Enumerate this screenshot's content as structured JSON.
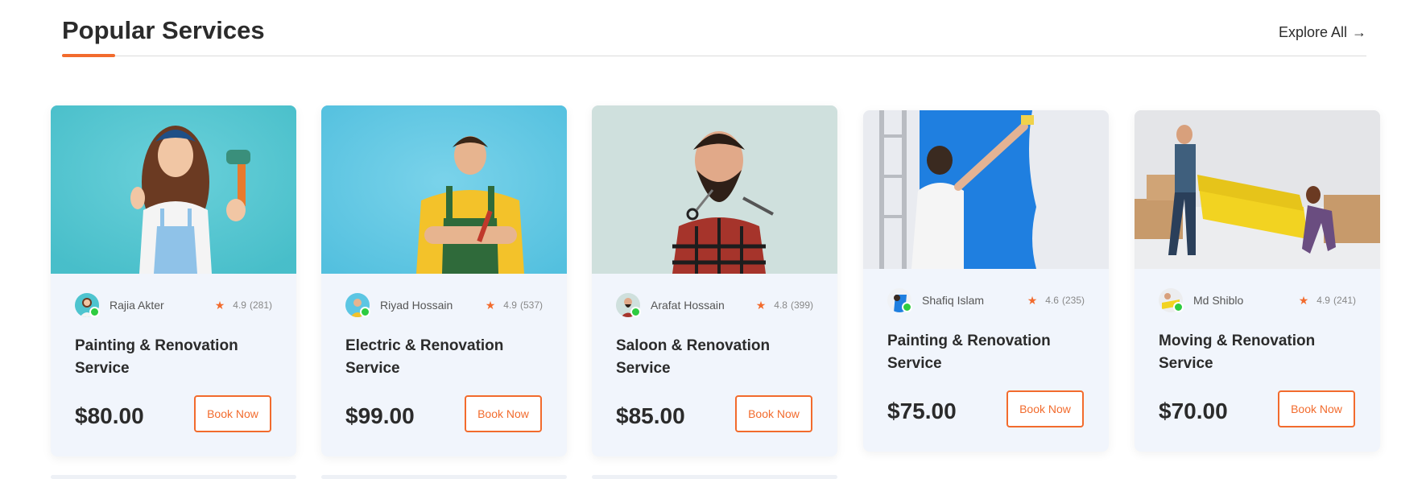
{
  "section": {
    "title": "Popular Services",
    "explore_label": "Explore All",
    "explore_arrow": "→"
  },
  "colors": {
    "accent": "#f26b2d",
    "card_bg": "#f1f5fc",
    "online": "#2ecc40"
  },
  "cards": [
    {
      "image": "woman-painter-with-roller",
      "provider": "Rajia Akter",
      "rating": "4.9",
      "reviews": "(281)",
      "title": "Painting & Renovation Service",
      "price": "$80.00",
      "button": "Book Now"
    },
    {
      "image": "man-electrician-in-overalls",
      "provider": "Riyad Hossain",
      "rating": "4.9",
      "reviews": "(537)",
      "title": "Electric & Renovation Service",
      "price": "$99.00",
      "button": "Book Now"
    },
    {
      "image": "bearded-barber-with-scissors",
      "provider": "Arafat Hossain",
      "rating": "4.8",
      "reviews": "(399)",
      "title": "Saloon & Renovation Service",
      "price": "$85.00",
      "button": "Book Now"
    },
    {
      "image": "man-painting-wall-blue",
      "provider": "Shafiq Islam",
      "rating": "4.6",
      "reviews": "(235)",
      "title": "Painting & Renovation Service",
      "price": "$75.00",
      "button": "Book Now"
    },
    {
      "image": "movers-carrying-yellow-sofa",
      "provider": "Md Shiblo",
      "rating": "4.9",
      "reviews": "(241)",
      "title": "Moving & Renovation Service",
      "price": "$70.00",
      "button": "Book Now"
    }
  ]
}
